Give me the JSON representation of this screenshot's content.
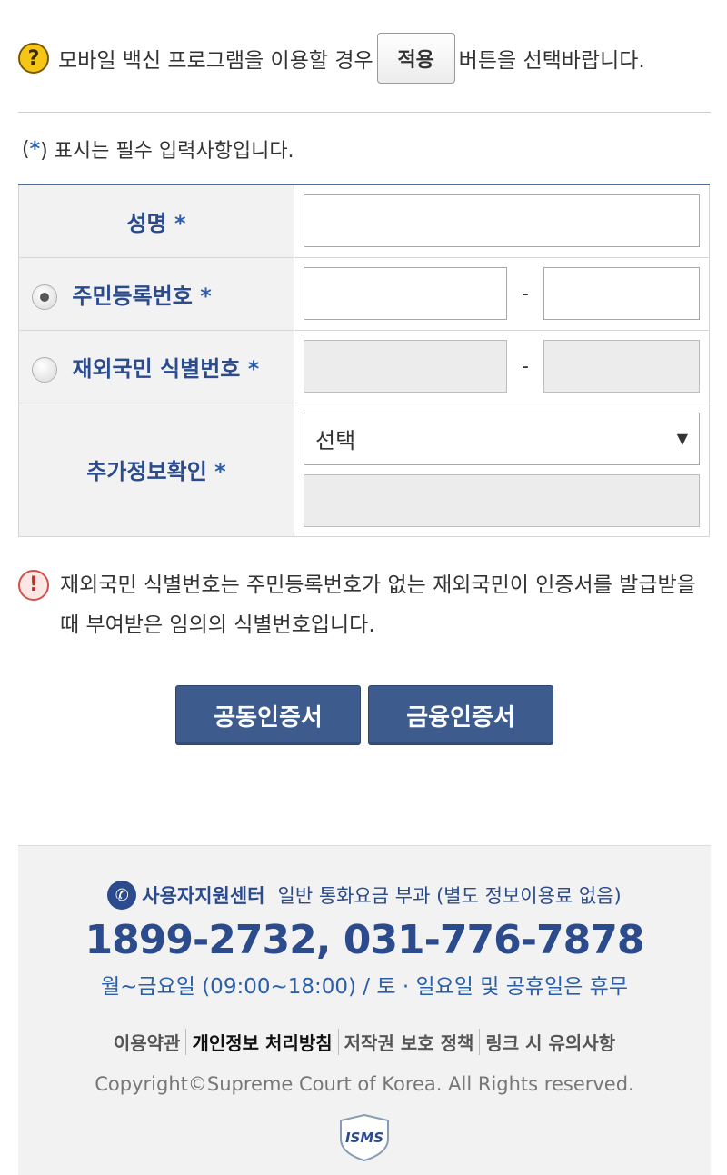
{
  "top_notice": {
    "before": "모바일 백신 프로그램을 이용할 경우",
    "apply_label": "적용",
    "after": "버튼을 선택바랍니다."
  },
  "required_note": {
    "open": "(",
    "star": "*",
    "text": ") 표시는 필수 입력사항입니다."
  },
  "form": {
    "name_label": "성명",
    "rrn_label": "주민등록번호",
    "foreign_label": "재외국민 식별번호",
    "extra_label": "추가정보확인",
    "required_mark": "*",
    "dash": "-",
    "select_value": "선택"
  },
  "info_notice": "재외국민 식별번호는 주민등록번호가 없는 재외국민이 인증서를 발급받을 때 부여받은 임의의 식별번호입니다.",
  "buttons": {
    "joint_cert": "공동인증서",
    "financial_cert": "금융인증서"
  },
  "footer": {
    "support_title": "사용자지원센터",
    "support_desc": "일반 통화요금 부과 (별도 정보이용료 없음)",
    "phones": "1899-2732, 031-776-7878",
    "hours": "월~금요일 (09:00~18:00) / 토 · 일요일 및 공휴일은 휴무",
    "links": [
      "이용약관",
      "개인정보 처리방침",
      "저작권 보호 정책",
      "링크 시 유의사항"
    ],
    "copyright": "Copyright©Supreme Court of Korea. All Rights reserved.",
    "badge_text": "ISMS"
  }
}
